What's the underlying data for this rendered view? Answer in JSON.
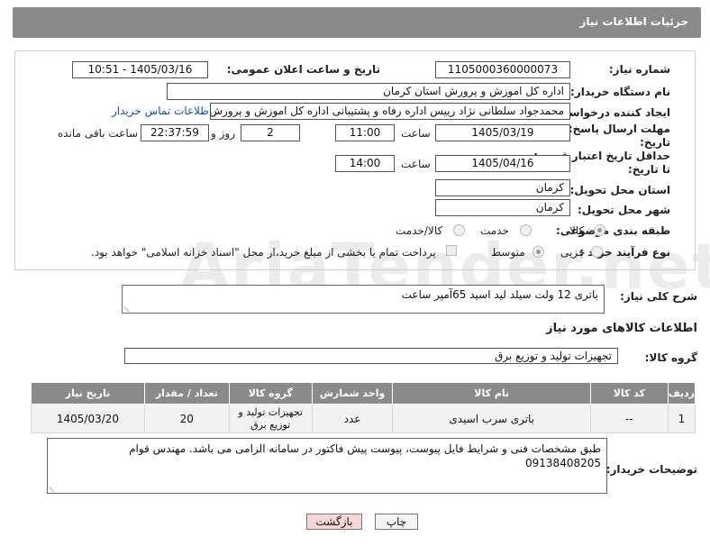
{
  "header": {
    "title": "جزئیات اطلاعات نیاز"
  },
  "form": {
    "need_number_label": "شماره نیاز:",
    "need_number": "1105000360000073",
    "announce_label": "تاریخ و ساعت اعلان عمومی:",
    "announce_value": "1405/03/16 - 10:51",
    "buyer_org_label": "نام دستگاه خریدار:",
    "buyer_org": "اداره کل اموزش و پرورش استان کرمان",
    "requester_label": "ایجاد کننده درخواست:",
    "requester": "محمدجواد سلطانی نژاد رییس اداره رفاه و پشتیبانی اداره کل اموزش و پرورش اس",
    "contact_link": "اطلاعات تماس خریدار",
    "reply_deadline_label_1": "مهلت ارسال پاسخ: تا",
    "reply_deadline_label_2": "تاریخ:",
    "reply_date": "1405/03/19",
    "time_label": "ساعت",
    "reply_time": "11:00",
    "days_value": "2",
    "days_label": "روز و",
    "remaining_time": "22:37:59",
    "remaining_label": "ساعت باقی مانده",
    "price_deadline_label_1": "حداقل تاریخ اعتبار قیمت:",
    "price_deadline_label_2": "تا تاریخ:",
    "price_date": "1405/04/16",
    "price_time": "14:00",
    "province_label": "استان محل تحویل:",
    "province": "کرمان",
    "city_label": "شهر محل تحویل:",
    "city": "کرمان",
    "category_label": "طبقه بندی موضوعی:",
    "category_options": [
      "کالا",
      "خدمت",
      "کالا/خدمت"
    ],
    "process_label": "نوع فرآیند خرید :",
    "process_options": [
      "جزیی",
      "متوسط"
    ],
    "payment_note": "پرداخت تمام یا بخشی از مبلغ خرید،از محل \"اسناد خزانه اسلامی\" خواهد بود."
  },
  "summary": {
    "label": "شرح کلی نیاز:",
    "text": "باتری 12 ولت سیلد لید اسید 65آمپر ساعت"
  },
  "goods": {
    "section_title": "اطلاعات کالاهای مورد نیاز",
    "group_label": "گروه کالا:",
    "group_value": "تجهیزات تولید و توزیع برق",
    "columns": [
      "ردیف",
      "کد کالا",
      "نام کالا",
      "واحد شمارش",
      "گروه کالا",
      "تعداد / مقدار",
      "تاریخ نیاز"
    ],
    "rows": [
      [
        "1",
        "--",
        "باتری سرب اسیدی",
        "عدد",
        "تجهیزات تولید و توزیع برق",
        "20",
        "1405/03/20"
      ]
    ]
  },
  "buyer_notes": {
    "label": "توضیحات خریدار:",
    "text": "طبق مشخصات فنی و شرایط فایل پیوست، پیوست پیش فاکتور در سامانه الزامی می باشد. مهندس قوام 09138408205"
  },
  "buttons": {
    "print": "چاپ",
    "back": "بازگشت"
  },
  "watermark": "AriaTender.net"
}
